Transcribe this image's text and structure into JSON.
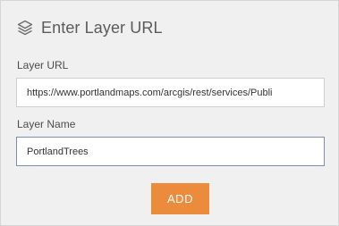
{
  "header": {
    "title": "Enter Layer URL",
    "icon": "layers-icon"
  },
  "form": {
    "url_label": "Layer URL",
    "url_value": "https://www.portlandmaps.com/arcgis/rest/services/Publi",
    "name_label": "Layer Name",
    "name_value": "PortlandTrees",
    "add_label": "ADD"
  },
  "colors": {
    "panel_background": "#f0f0f0",
    "button_accent": "#ec8b3b",
    "focus_border": "#7a8fb3"
  }
}
